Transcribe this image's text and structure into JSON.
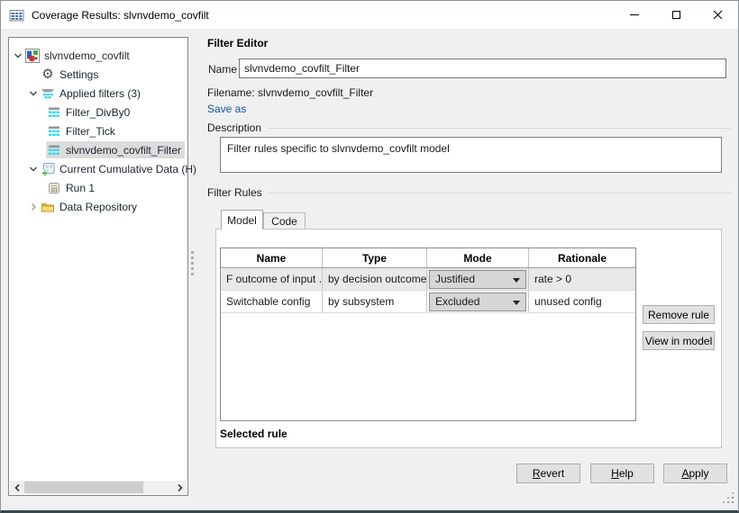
{
  "window": {
    "title": "Coverage Results: slvnvdemo_covfilt",
    "controls": [
      "minimize",
      "maximize",
      "close"
    ]
  },
  "colors": {
    "titlebar_bg": "#ffffff",
    "dialog_bg": "#f0f0f0",
    "accent_cyan": "#3ad9ea",
    "link_blue": "#1257a5",
    "tree_selection_gray": "#dcdcdc",
    "table_row_selected": "#e9e9e9",
    "folder_yellow": "#f5c44e",
    "button_bg": "#e1e1e1"
  },
  "tree": {
    "items": [
      {
        "label": "slvnvdemo_covfilt",
        "icon": "model-icon",
        "depth": 0,
        "state": "expanded",
        "selected": false
      },
      {
        "label": "Settings",
        "icon": "gear-icon",
        "depth": 1,
        "state": "leaf",
        "selected": false
      },
      {
        "label": "Applied filters (3)",
        "icon": "applied-filters-icon",
        "depth": 1,
        "state": "expanded",
        "selected": false
      },
      {
        "label": "Filter_DivBy0",
        "icon": "filter-icon",
        "depth": 2,
        "state": "leaf",
        "selected": false
      },
      {
        "label": "Filter_Tick",
        "icon": "filter-icon",
        "depth": 2,
        "state": "leaf",
        "selected": false
      },
      {
        "label": "slvnvdemo_covfilt_Filter",
        "icon": "filter-icon",
        "depth": 2,
        "state": "leaf",
        "selected": true
      },
      {
        "label": "Current Cumulative Data (H)",
        "icon": "cumulative-data-icon",
        "depth": 1,
        "state": "expanded",
        "selected": false
      },
      {
        "label": "Run 1",
        "icon": "run-icon",
        "depth": 2,
        "state": "leaf",
        "selected": false
      },
      {
        "label": "Data Repository",
        "icon": "folder-icon",
        "depth": 1,
        "state": "collapsed",
        "selected": false
      }
    ]
  },
  "editor": {
    "heading": "Filter Editor",
    "name_label": "Name",
    "name_value": "slvnvdemo_covfilt_Filter",
    "filename_text": "Filename: slvnvdemo_covfilt_Filter",
    "save_as_label": "Save as",
    "description_label": "Description",
    "description_value": "Filter rules specific to slvnvdemo_covfilt model",
    "filter_rules_label": "Filter Rules",
    "tabs": [
      {
        "label": "Model",
        "active": true
      },
      {
        "label": "Code",
        "active": false
      }
    ],
    "rules_table": {
      "headers": [
        "Name",
        "Type",
        "Mode",
        "Rationale"
      ],
      "rows": [
        {
          "name": "F outcome of input ...",
          "type": "by decision outcome",
          "mode": "Justified",
          "rationale": "rate > 0",
          "selected": true
        },
        {
          "name": "Switchable config",
          "type": "by subsystem",
          "mode": "Excluded",
          "rationale": "unused config",
          "selected": false
        }
      ]
    },
    "remove_rule_button": "Remove rule",
    "view_in_model_button": "View in model",
    "selected_rule_label": "Selected rule",
    "footer_buttons": [
      "Revert",
      "Help",
      "Apply"
    ]
  }
}
